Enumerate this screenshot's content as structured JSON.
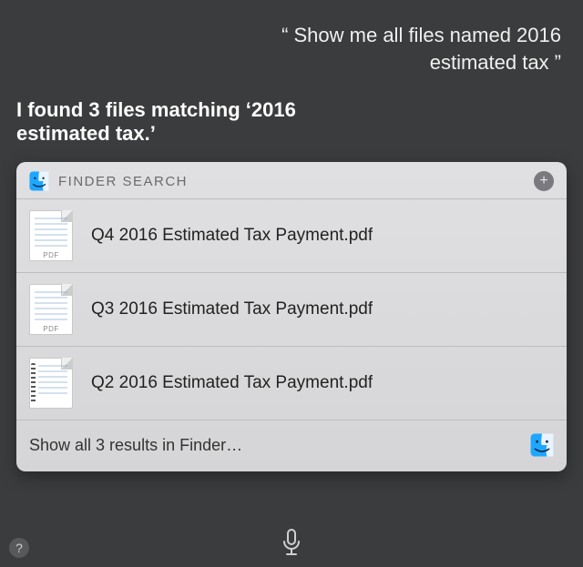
{
  "user_utterance": "“ Show me all files named 2016 estimated tax ”",
  "siri_response": "I found 3 files matching ‘2016 estimated tax.’",
  "card": {
    "title": "FINDER SEARCH",
    "add_label": "+",
    "results": [
      {
        "name": "Q4 2016 Estimated Tax Payment.pdf",
        "badge": "PDF",
        "kind": "pdf"
      },
      {
        "name": "Q3 2016 Estimated Tax Payment.pdf",
        "badge": "PDF",
        "kind": "pdf"
      },
      {
        "name": "Q2 2016 Estimated Tax Payment.pdf",
        "badge": "",
        "kind": "spiral"
      }
    ],
    "footer_text": "Show all 3 results in Finder…"
  },
  "help_label": "?",
  "icons": {
    "finder": "finder-icon",
    "plus": "plus-icon",
    "mic": "microphone-icon",
    "help": "help-icon",
    "document": "document-icon"
  }
}
